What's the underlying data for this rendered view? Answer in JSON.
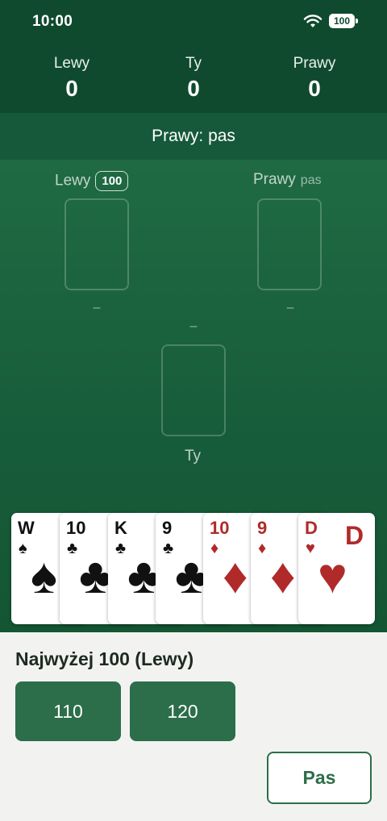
{
  "status": {
    "time": "10:00",
    "battery": "100"
  },
  "scores": [
    {
      "name": "Lewy",
      "value": "0"
    },
    {
      "name": "Ty",
      "value": "0"
    },
    {
      "name": "Prawy",
      "value": "0"
    }
  ],
  "banner": "Prawy: pas",
  "table": {
    "left": {
      "label": "Lewy",
      "bid": "100",
      "card_value": "–"
    },
    "right": {
      "label": "Prawy",
      "note": "pas",
      "card_value": "–"
    },
    "you": {
      "label": "Ty",
      "card_value": "–"
    }
  },
  "hand": [
    {
      "rank": "W",
      "suit": "♠",
      "color": "black"
    },
    {
      "rank": "10",
      "suit": "♣",
      "color": "black"
    },
    {
      "rank": "K",
      "suit": "♣",
      "color": "black"
    },
    {
      "rank": "9",
      "suit": "♣",
      "color": "black"
    },
    {
      "rank": "10",
      "suit": "♦",
      "color": "red"
    },
    {
      "rank": "9",
      "suit": "♦",
      "color": "red"
    },
    {
      "rank": "D",
      "suit": "♥",
      "color": "red"
    }
  ],
  "bidding": {
    "highest": "Najwyżej 100 (Lewy)",
    "options": [
      "110",
      "120"
    ],
    "pass_label": "Pas"
  },
  "colors": {
    "felt": "#1f6a43",
    "header": "#0f4a2e",
    "button": "#2c6e4a",
    "red_suit": "#b02a2a"
  }
}
